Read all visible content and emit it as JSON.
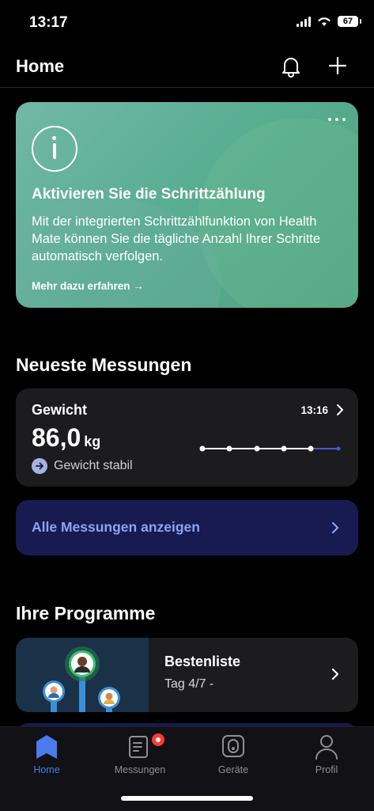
{
  "status_bar": {
    "time": "13:17",
    "battery": "67"
  },
  "header": {
    "title": "Home"
  },
  "promo": {
    "title": "Aktivieren Sie die Schrittzählung",
    "body": "Mit der integrierten Schrittzählfunktion von Health Mate können Sie die tägliche Anzahl Ihrer Schritte automatisch verfolgen.",
    "link": "Mehr dazu erfahren →"
  },
  "measurements": {
    "section_title": "Neueste Messungen",
    "weight": {
      "label": "Gewicht",
      "time": "13:16",
      "value": "86,0",
      "unit": "kg",
      "trend": "Gewicht stabil"
    },
    "all_button": "Alle Messungen anzeigen"
  },
  "programs": {
    "section_title": "Ihre Programme",
    "card": {
      "title": "Bestenliste",
      "subtitle": "Tag 4/7 -"
    }
  },
  "tabbar": {
    "items": [
      {
        "label": "Home",
        "icon": "home-icon",
        "active": true
      },
      {
        "label": "Messungen",
        "icon": "measurements-icon",
        "active": false
      },
      {
        "label": "Geräte",
        "icon": "devices-icon",
        "active": false
      },
      {
        "label": "Profil",
        "icon": "profile-icon",
        "active": false
      }
    ]
  },
  "colors": {
    "accent": "#4b7bec",
    "promo": "#5aae92",
    "button_bg": "#171b52",
    "button_text": "#8da3f0"
  }
}
